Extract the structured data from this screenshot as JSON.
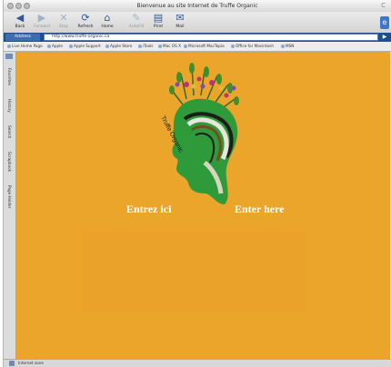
{
  "window": {
    "title": "Bienvenue au site Internet de Truffe Organic",
    "title_right": "C"
  },
  "toolbar": {
    "buttons": [
      {
        "label": "Back",
        "icon": "back-arrow-icon",
        "glyph": "◀"
      },
      {
        "label": "Forward",
        "icon": "forward-arrow-icon",
        "glyph": "▶"
      },
      {
        "label": "Stop",
        "icon": "stop-icon",
        "glyph": "✕"
      },
      {
        "label": "Refresh",
        "icon": "refresh-icon",
        "glyph": "⟳"
      },
      {
        "label": "Home",
        "icon": "home-icon",
        "glyph": "⌂"
      },
      {
        "label": "AutoFill",
        "icon": "autofill-icon",
        "glyph": "✎"
      },
      {
        "label": "Print",
        "icon": "print-icon",
        "glyph": "▤"
      },
      {
        "label": "Mail",
        "icon": "mail-icon",
        "glyph": "✉"
      }
    ],
    "right_glyph": "e"
  },
  "address": {
    "label": "Address",
    "url": "http://www.truffe-organic.ca",
    "go_glyph": "▶"
  },
  "favorites": [
    "Live Home Page",
    "Apple",
    "Apple Support",
    "Apple Store",
    "iTools",
    "Mac OS X",
    "Microsoft MacTopia",
    "Office for Macintosh",
    "MSN"
  ],
  "sidebar_tabs": [
    "Favorites",
    "History",
    "Search",
    "Scrapbook",
    "Page Holder"
  ],
  "content": {
    "enter_french": "Entrez ici",
    "enter_english": "Enter here",
    "logo_text": "Truffe Organic"
  },
  "status": {
    "text": "Internet zone"
  },
  "colors": {
    "page_background": "#eca52b",
    "link_text": "#ffffff",
    "address_bar": "#1f4f8a"
  }
}
